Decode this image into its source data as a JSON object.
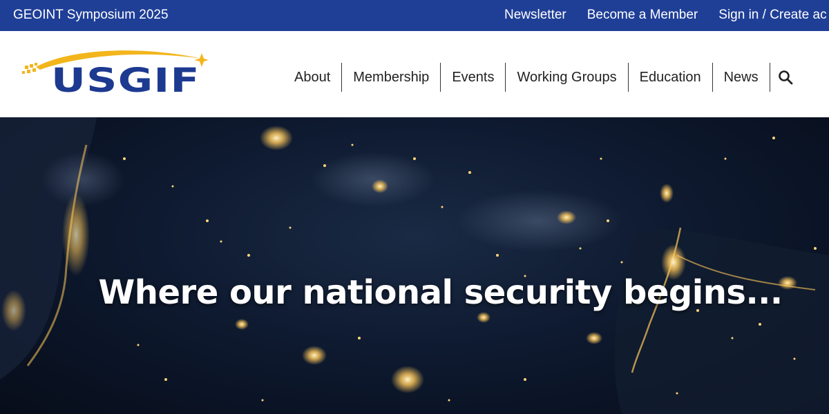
{
  "topbar": {
    "event_link": "GEOINT Symposium 2025",
    "links": [
      "Newsletter",
      "Become a Member",
      "Sign in / Create ac"
    ]
  },
  "logo": {
    "text": "USGIF"
  },
  "nav": {
    "items": [
      "About",
      "Membership",
      "Events",
      "Working Groups",
      "Education",
      "News"
    ],
    "search_icon": "search-icon"
  },
  "hero": {
    "headline": "Where our national security begins..."
  },
  "colors": {
    "topbar_bg": "#1f3f97",
    "logo_blue": "#1d3a91",
    "logo_gold": "#f2b51c",
    "hero_bg": "#0e1a30",
    "city_lights": "#ffc85a"
  }
}
